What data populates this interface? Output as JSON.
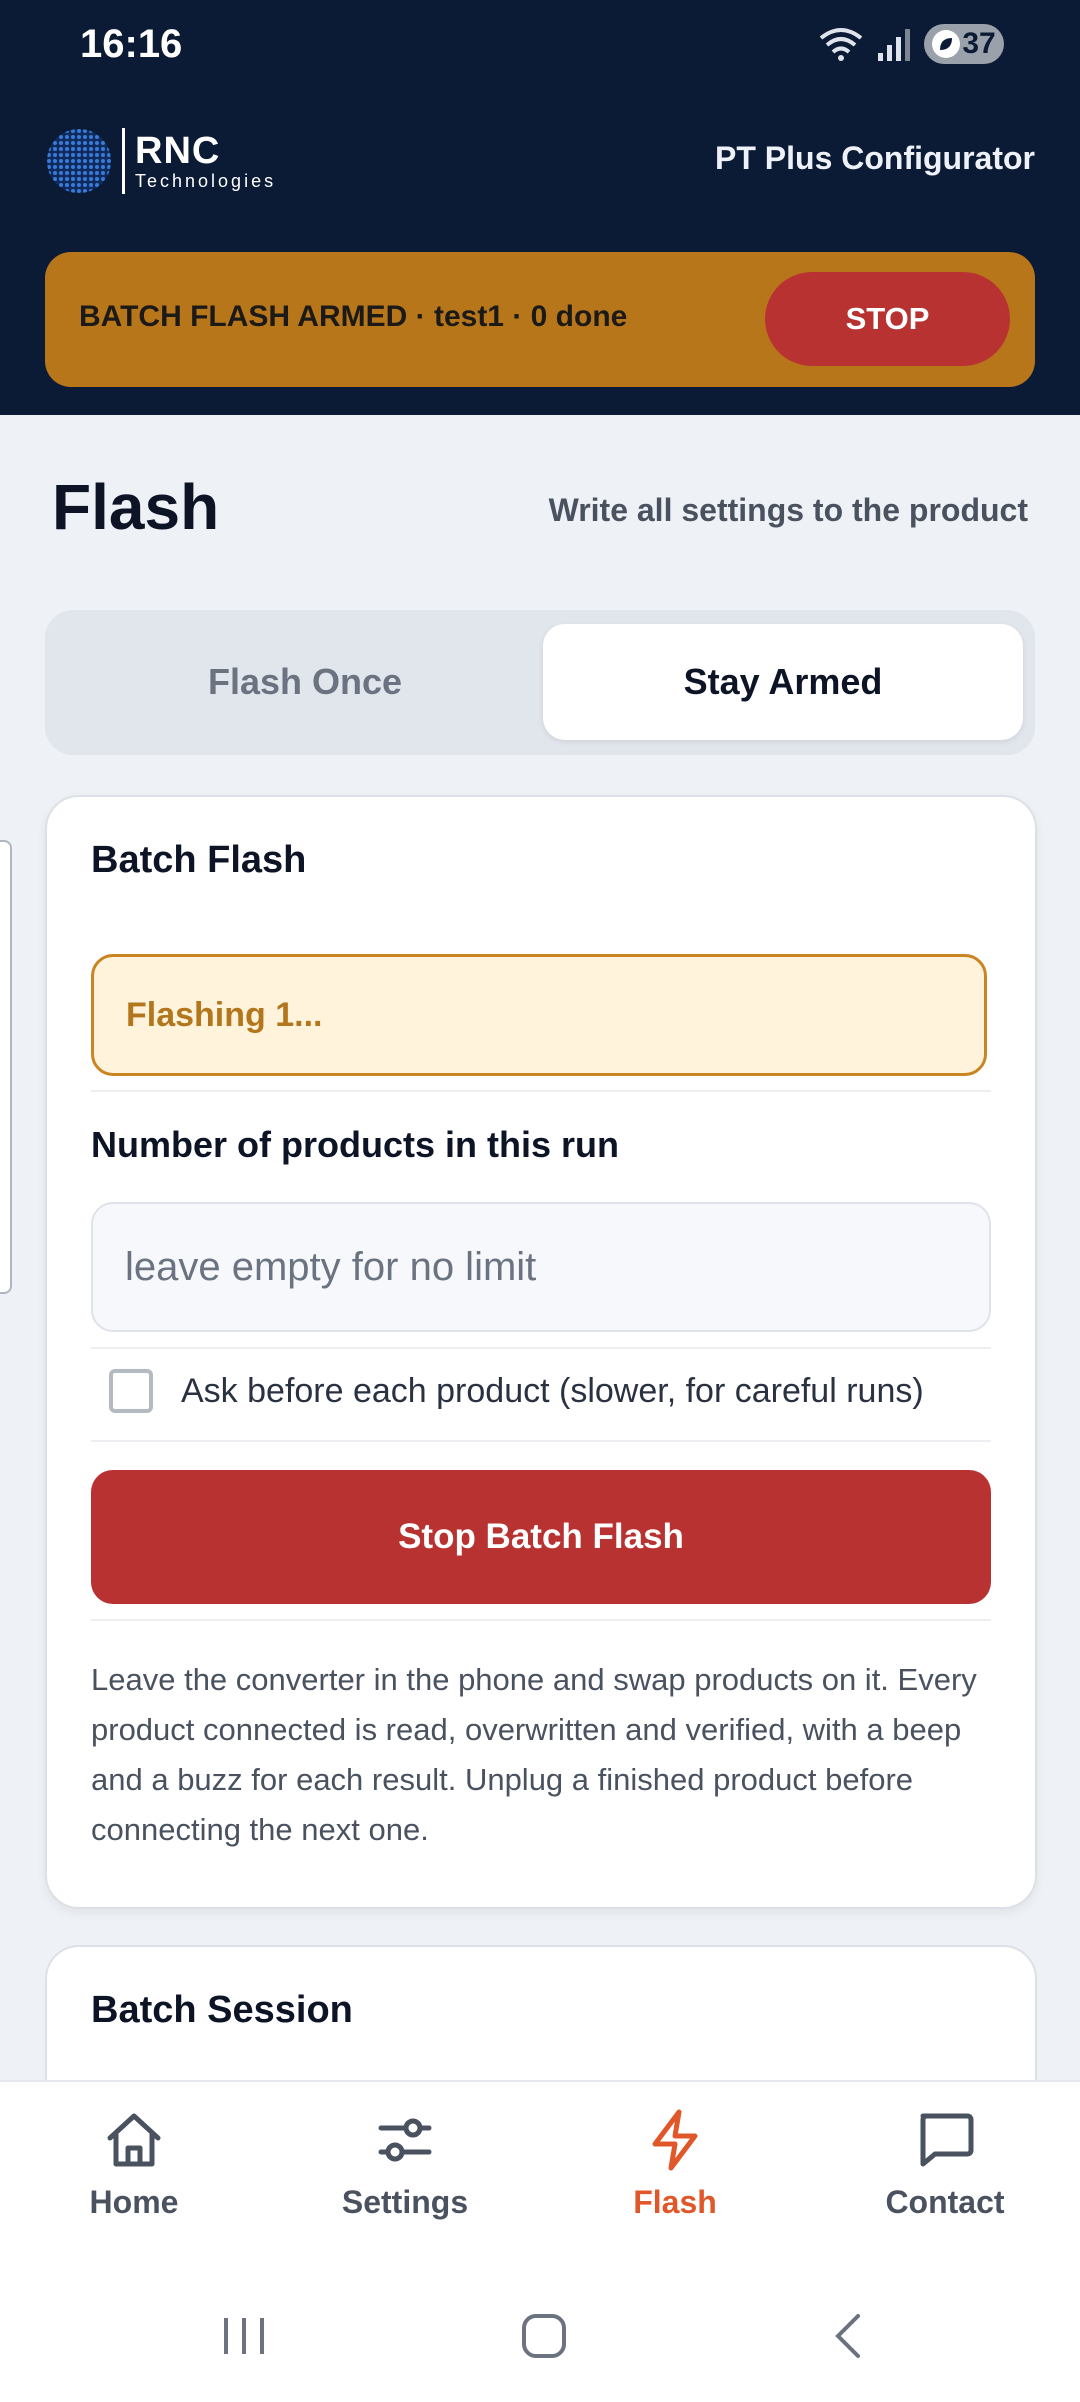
{
  "status_bar": {
    "time": "16:16",
    "battery": "37"
  },
  "header": {
    "logo": {
      "name": "RNC",
      "sub": "Technologies"
    },
    "app_title": "PT Plus Configurator",
    "armed_banner": {
      "text": "BATCH FLASH ARMED · test1 · 0 done",
      "stop_label": "STOP"
    }
  },
  "page": {
    "title": "Flash",
    "subtitle": "Write all settings to the product"
  },
  "mode_toggle": {
    "once_label": "Flash Once",
    "armed_label": "Stay Armed",
    "selected": "Stay Armed"
  },
  "batch_card": {
    "title": "Batch Flash",
    "status": "Flashing 1...",
    "count_label": "Number of products in this run",
    "count_placeholder": "leave empty for no limit",
    "ask_label": "Ask before each product (slower, for careful runs)",
    "ask_checked": false,
    "stop_label": "Stop Batch Flash",
    "help_text": "Leave the converter in the phone and swap products on it. Every product connected is read, overwritten and verified, with a beep and a buzz for each result. Unplug a finished product before connecting the next one."
  },
  "session_card": {
    "title": "Batch Session"
  },
  "bottom_nav": {
    "items": [
      {
        "label": "Home",
        "icon": "home-icon"
      },
      {
        "label": "Settings",
        "icon": "sliders-icon"
      },
      {
        "label": "Flash",
        "icon": "lightning-icon"
      },
      {
        "label": "Contact",
        "icon": "chat-icon"
      }
    ],
    "active": "Flash"
  },
  "colors": {
    "header_bg": "#0c1b35",
    "banner_amber": "#b8761a",
    "stop_red": "#b93232",
    "active_orange": "#e0582a",
    "status_text": "#b3761c"
  }
}
